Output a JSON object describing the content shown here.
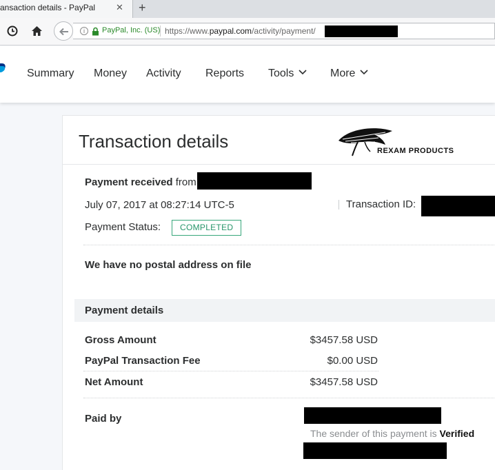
{
  "browser": {
    "tab_title": "ansaction details - PayPal",
    "tab_close": "✕",
    "new_tab": "+",
    "site_identity": "PayPal, Inc. (US)",
    "url_prefix": "https://www.",
    "url_domain": "paypal.com",
    "url_path": "/activity/payment/"
  },
  "nav": {
    "items": [
      {
        "label": "Summary"
      },
      {
        "label": "Money"
      },
      {
        "label": "Activity"
      },
      {
        "label": "Reports"
      },
      {
        "label": "Tools",
        "has_dropdown": true
      },
      {
        "label": "More",
        "has_dropdown": true
      }
    ]
  },
  "page": {
    "title": "Transaction details",
    "merchant_logo_text": "REXAM PRODUCTS"
  },
  "transaction": {
    "heading_bold": "Payment received",
    "heading_from": " from",
    "datetime": "July 07, 2017 at 08:27:14 UTC-5",
    "transaction_id_label": "Transaction ID:",
    "status_label": "Payment Status:",
    "status_value": "COMPLETED",
    "postal_note": "We have no postal address on file"
  },
  "payment_details": {
    "heading": "Payment details",
    "rows": [
      {
        "label": "Gross Amount",
        "value": "$3457.58 USD"
      },
      {
        "label": "PayPal Transaction Fee",
        "value": "$0.00 USD"
      },
      {
        "label": "Net Amount",
        "value": "$3457.58 USD"
      }
    ],
    "paid_by_label": "Paid by",
    "sender_note_prefix": "The sender of this payment is ",
    "sender_note_status": "Verified"
  },
  "colors": {
    "status_green": "#27956a",
    "paypal_blue": "#0070ba"
  }
}
